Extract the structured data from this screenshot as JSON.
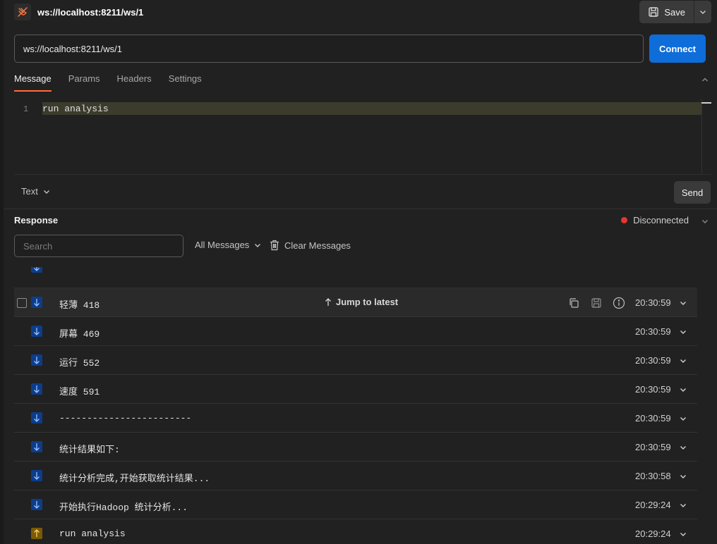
{
  "header": {
    "title": "ws://localhost:8211/ws/1",
    "save_label": "Save"
  },
  "request": {
    "url": "ws://localhost:8211/ws/1",
    "connect_label": "Connect",
    "tabs": [
      {
        "label": "Message",
        "active": true
      },
      {
        "label": "Params",
        "active": false
      },
      {
        "label": "Headers",
        "active": false
      },
      {
        "label": "Settings",
        "active": false
      }
    ],
    "editor": {
      "line_number": "1",
      "content": "run analysis"
    },
    "format": "Text",
    "send_label": "Send"
  },
  "response": {
    "title": "Response",
    "status": "Disconnected",
    "status_color": "#e5372f",
    "search_placeholder": "Search",
    "filter_label": "All Messages",
    "clear_label": "Clear Messages",
    "jump_label": "Jump to latest",
    "messages": [
      {
        "direction": "in",
        "text": "轻薄 418",
        "time": "20:30:59"
      },
      {
        "direction": "in",
        "text": "屏幕 469",
        "time": "20:30:59"
      },
      {
        "direction": "in",
        "text": "运行 552",
        "time": "20:30:59"
      },
      {
        "direction": "in",
        "text": "速度 591",
        "time": "20:30:59"
      },
      {
        "direction": "in",
        "text": "------------------------",
        "time": "20:30:59"
      },
      {
        "direction": "in",
        "text": "统计结果如下:",
        "time": "20:30:59"
      },
      {
        "direction": "in",
        "text": "统计分析完成,开始获取统计结果...",
        "time": "20:30:58"
      },
      {
        "direction": "in",
        "text": "开始执行Hadoop 统计分析...",
        "time": "20:29:24"
      },
      {
        "direction": "out",
        "text": "run analysis",
        "time": "20:29:24"
      }
    ]
  },
  "colors": {
    "accent": "#ff6c37",
    "connect": "#0f6dd9",
    "incoming": "#0c3d8a",
    "outgoing": "#7a5a05"
  }
}
